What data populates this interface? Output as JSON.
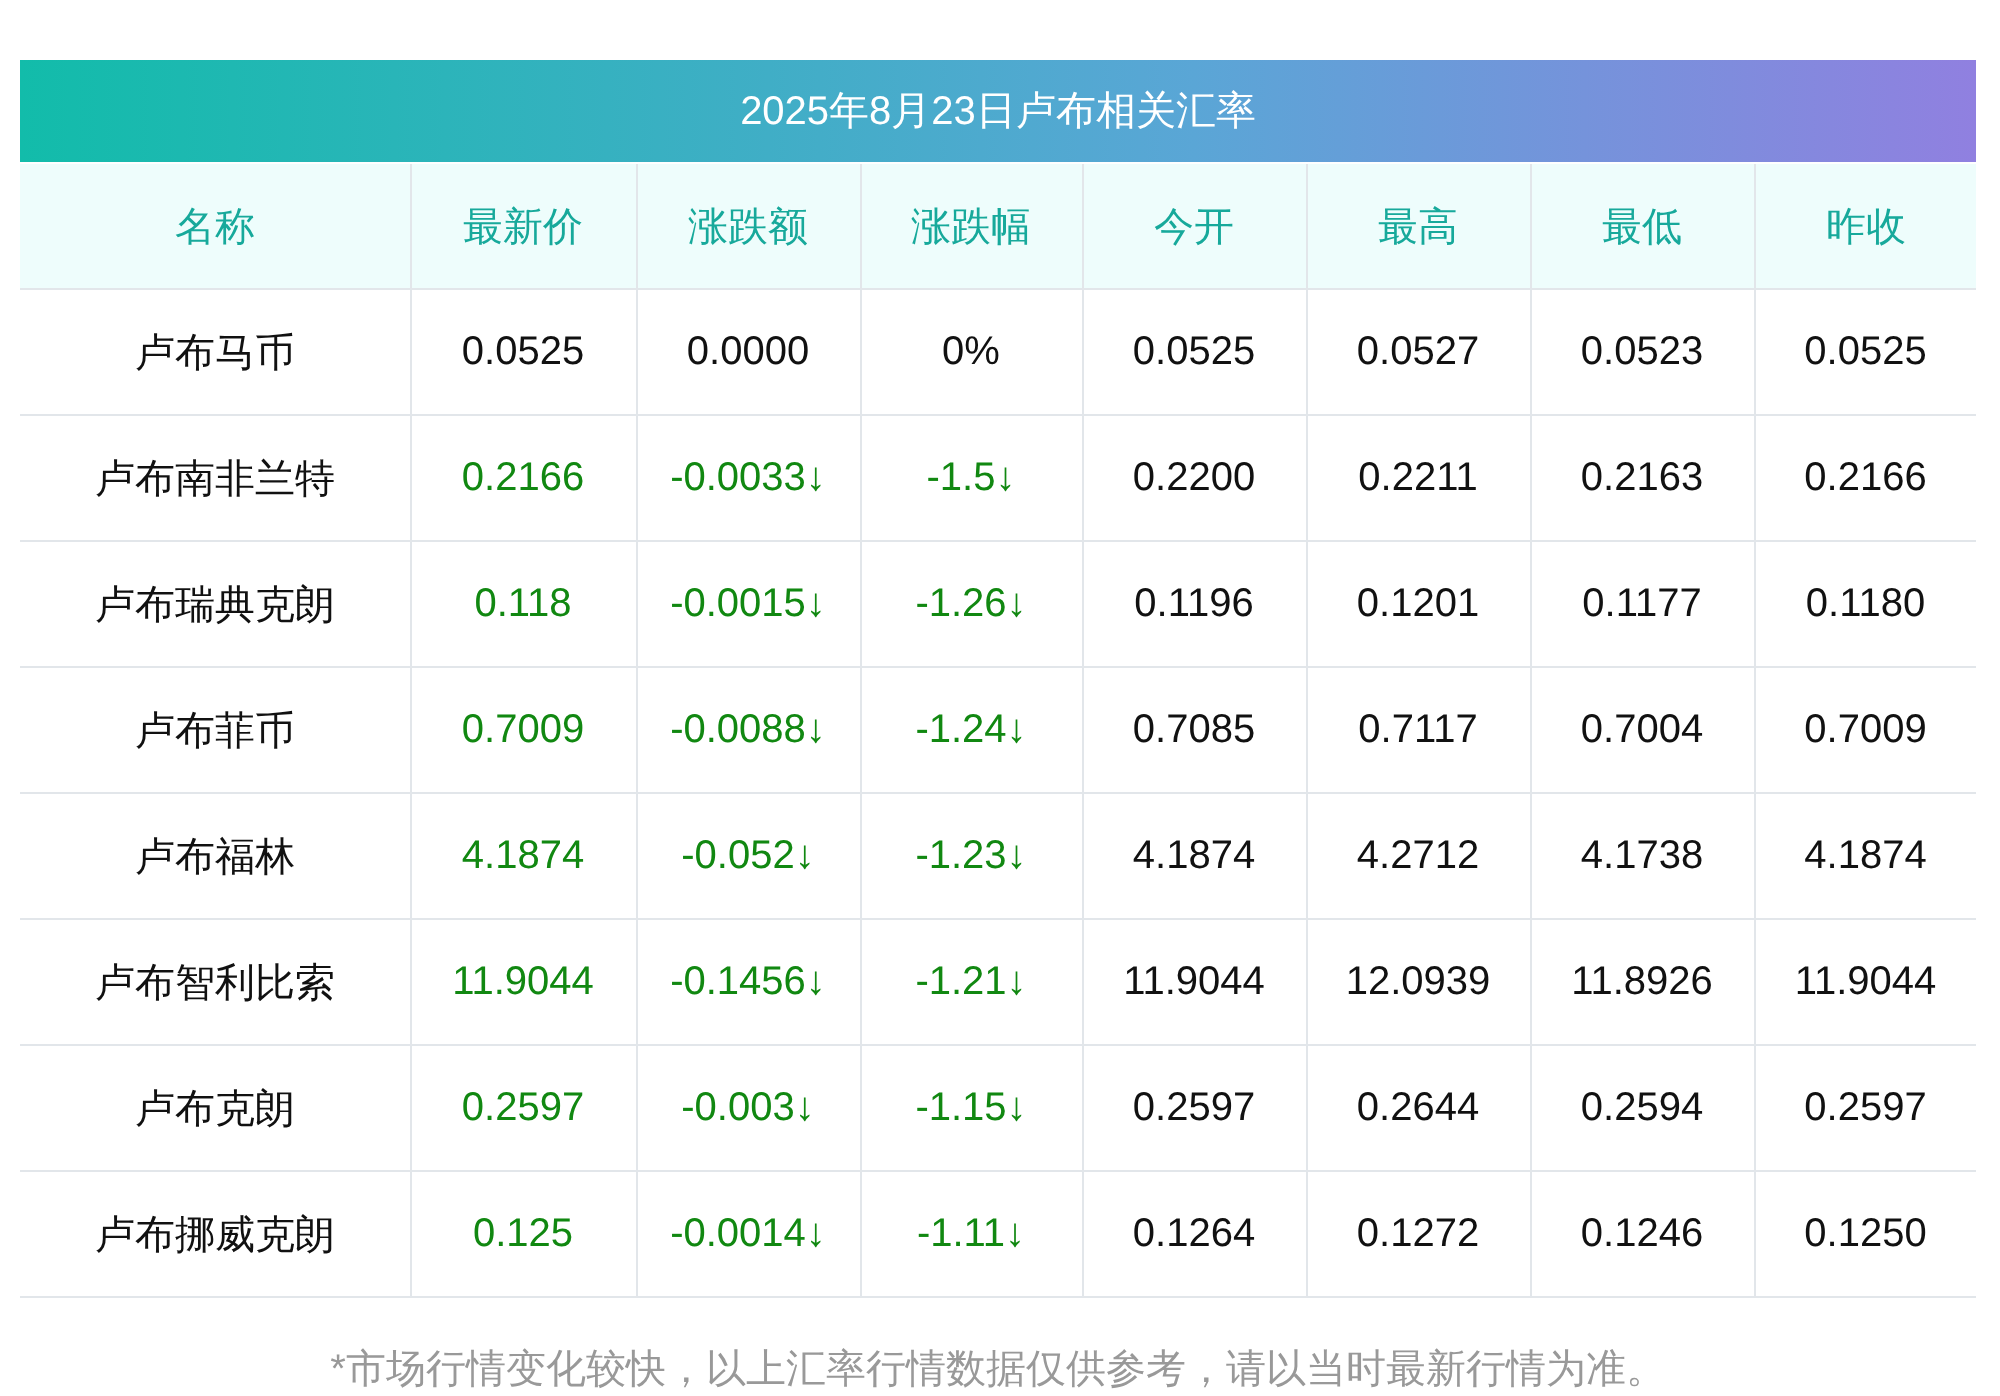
{
  "title": "2025年8月23日卢布相关汇率",
  "columns": [
    "名称",
    "最新价",
    "涨跌额",
    "涨跌幅",
    "今开",
    "最高",
    "最低",
    "昨收"
  ],
  "rows": [
    {
      "falling": false,
      "cells": [
        "卢布马币",
        "0.0525",
        "0.0000",
        "0%",
        "0.0525",
        "0.0527",
        "0.0523",
        "0.0525"
      ]
    },
    {
      "falling": true,
      "cells": [
        "卢布南非兰特",
        "0.2166",
        "-0.0033↓",
        "-1.5↓",
        "0.2200",
        "0.2211",
        "0.2163",
        "0.2166"
      ]
    },
    {
      "falling": true,
      "cells": [
        "卢布瑞典克朗",
        "0.118",
        "-0.0015↓",
        "-1.26↓",
        "0.1196",
        "0.1201",
        "0.1177",
        "0.1180"
      ]
    },
    {
      "falling": true,
      "cells": [
        "卢布菲币",
        "0.7009",
        "-0.0088↓",
        "-1.24↓",
        "0.7085",
        "0.7117",
        "0.7004",
        "0.7009"
      ]
    },
    {
      "falling": true,
      "cells": [
        "卢布福林",
        "4.1874",
        "-0.052↓",
        "-1.23↓",
        "4.1874",
        "4.2712",
        "4.1738",
        "4.1874"
      ]
    },
    {
      "falling": true,
      "cells": [
        "卢布智利比索",
        "11.9044",
        "-0.1456↓",
        "-1.21↓",
        "11.9044",
        "12.0939",
        "11.8926",
        "11.9044"
      ]
    },
    {
      "falling": true,
      "cells": [
        "卢布克朗",
        "0.2597",
        "-0.003↓",
        "-1.15↓",
        "0.2597",
        "0.2644",
        "0.2594",
        "0.2597"
      ]
    },
    {
      "falling": true,
      "cells": [
        "卢布挪威克朗",
        "0.125",
        "-0.0014↓",
        "-1.11↓",
        "0.1264",
        "0.1272",
        "0.1246",
        "0.1250"
      ]
    }
  ],
  "footnote": "*市场行情变化较快，以上汇率行情数据仅供参考，请以当时最新行情为准。"
}
